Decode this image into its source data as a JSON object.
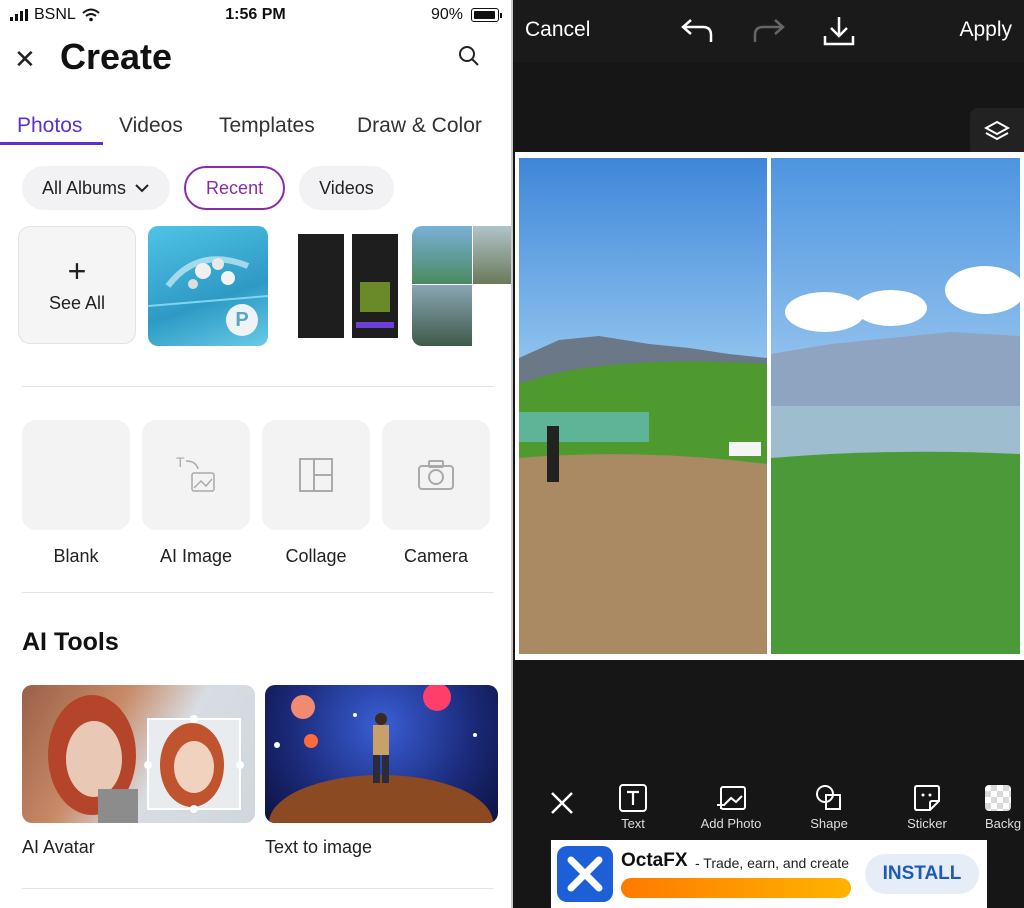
{
  "status": {
    "carrier": "BSNL",
    "time": "1:56 PM",
    "battery": "90%"
  },
  "left": {
    "title": "Create",
    "tabs": [
      "Photos",
      "Videos",
      "Templates",
      "Draw & Color"
    ],
    "filters": {
      "albums": "All Albums",
      "recent": "Recent",
      "videos": "Videos"
    },
    "see_all": "See All",
    "tools": [
      "Blank",
      "AI Image",
      "Collage",
      "Camera"
    ],
    "ai_title": "AI Tools",
    "ai_tools": [
      "AI Avatar",
      "Text to image"
    ]
  },
  "right": {
    "cancel": "Cancel",
    "apply": "Apply",
    "toolbar": [
      "Text",
      "Add Photo",
      "Shape",
      "Sticker",
      "Backg"
    ],
    "ad": {
      "brand": "OctaFX",
      "tagline": "- Trade, earn, and create",
      "install": "INSTALL"
    }
  },
  "colors": {
    "accent": "#5b2fd1",
    "recent_outline": "#8a2ca8",
    "editor_bg": "#161616"
  }
}
